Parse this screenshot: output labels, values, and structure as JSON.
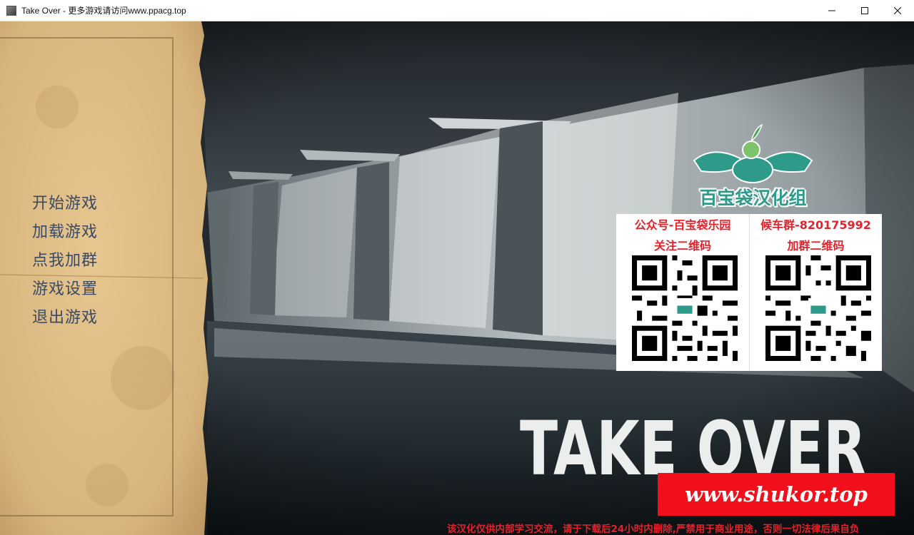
{
  "window": {
    "title": "Take Over - 更多游戏请访问www.ppacg.top",
    "controls": [
      "minimize-icon",
      "maximize-icon",
      "close-icon"
    ]
  },
  "menu": {
    "items": [
      {
        "label": "开始游戏"
      },
      {
        "label": "加载游戏"
      },
      {
        "label": "点我加群"
      },
      {
        "label": "游戏设置"
      },
      {
        "label": "退出游戏"
      }
    ]
  },
  "logo": {
    "text": "百宝袋汉化组"
  },
  "qr": {
    "left": {
      "title": "公众号-百宝袋乐园",
      "subtitle": "关注二维码"
    },
    "right": {
      "title": "候车群-820175992",
      "subtitle": "加群二维码"
    }
  },
  "game_title": "TAKE OVER",
  "watermark": "www.shukor.top",
  "disclaimer": "该汉化仅供内部学习交流，请于下载后24小时内删除,严禁用于商业用途，否则一切法律后果自负",
  "colors": {
    "menu_text": "#3b4a63",
    "accent_red": "#e3232b",
    "watermark_bg": "#f00f1a",
    "logo_teal": "#2e9b8a"
  }
}
